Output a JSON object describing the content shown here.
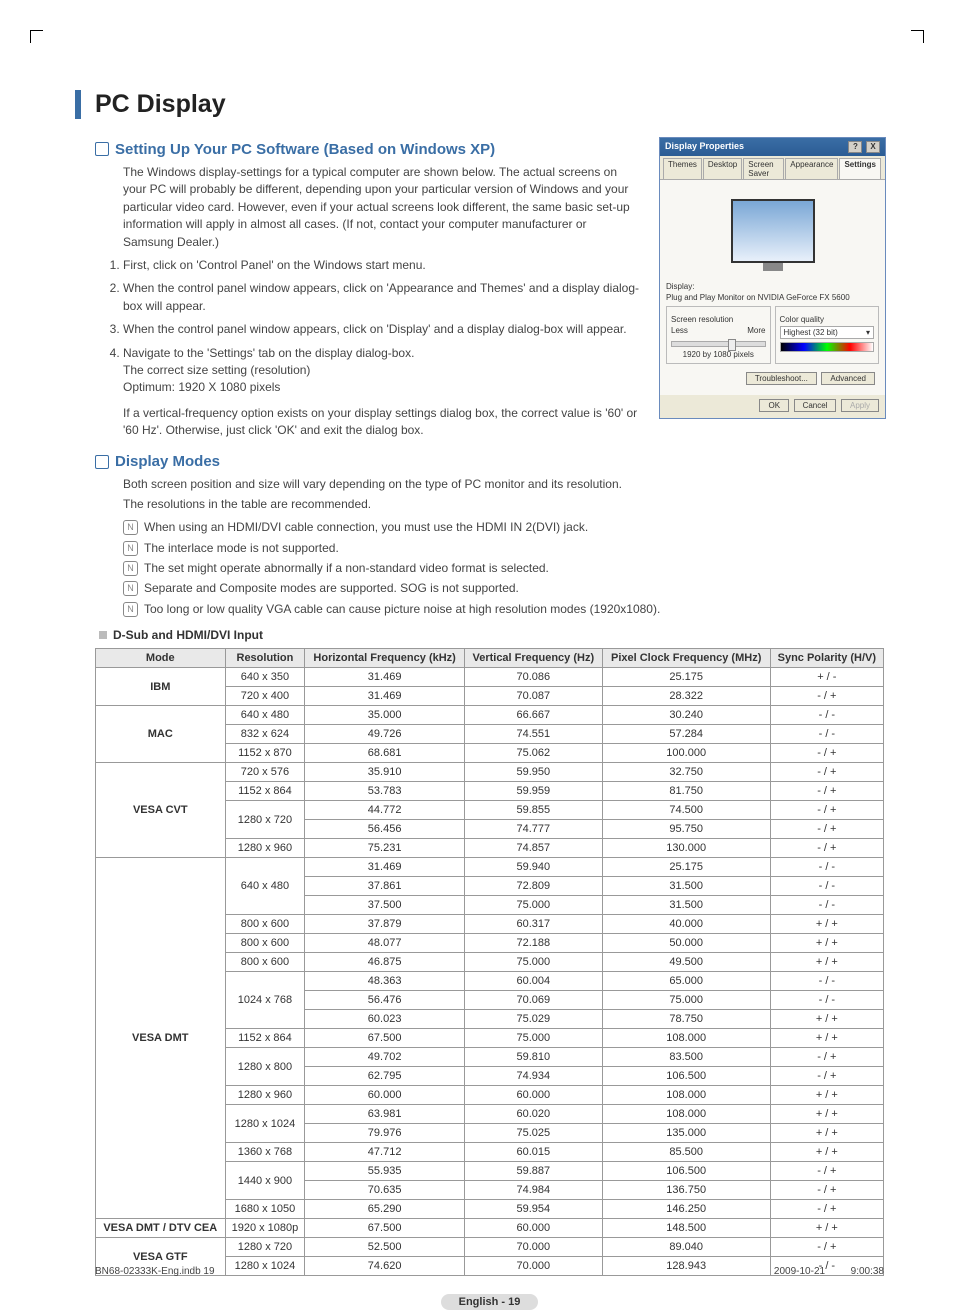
{
  "heading": "PC Display",
  "section1": {
    "title": "Setting Up Your PC Software (Based on Windows XP)",
    "intro": "The Windows display-settings for a typical computer are shown below. The actual screens on your PC will probably be different, depending upon your particular version of Windows and your particular video card. However, even if your actual screens look different, the same basic set-up information will apply in almost all cases. (If not, contact your computer manufacturer or Samsung Dealer.)",
    "steps": [
      "First, click on 'Control Panel' on the Windows start menu.",
      "When the control panel window appears, click on 'Appearance and Themes' and a display dialog-box will appear.",
      "When the control panel window appears, click on 'Display' and a display dialog-box will appear.",
      "Navigate to the 'Settings' tab on the display dialog-box."
    ],
    "step4_extra1": "The correct size setting (resolution)",
    "step4_extra2": "Optimum: 1920 X 1080 pixels",
    "step4_extra3": "If a vertical-frequency option exists on your display settings dialog box, the correct value is '60' or '60 Hz'. Otherwise, just click 'OK' and exit the dialog box."
  },
  "dialog": {
    "title": "Display Properties",
    "tabs": [
      "Themes",
      "Desktop",
      "Screen Saver",
      "Appearance",
      "Settings"
    ],
    "display_label": "Display:",
    "display_value": "Plug and Play Monitor on NVIDIA GeForce FX 5600",
    "sr_label": "Screen resolution",
    "sr_less": "Less",
    "sr_more": "More",
    "sr_value": "1920 by 1080 pixels",
    "cq_label": "Color quality",
    "cq_value": "Highest (32 bit)",
    "btn_trouble": "Troubleshoot...",
    "btn_adv": "Advanced",
    "btn_ok": "OK",
    "btn_cancel": "Cancel",
    "btn_apply": "Apply"
  },
  "section2": {
    "title": "Display Modes",
    "line1": "Both screen position and size will vary depending on the type of PC monitor and its resolution.",
    "line2": "The resolutions in the table are recommended.",
    "notes": [
      "When using an HDMI/DVI cable connection, you must use the HDMI IN 2(DVI) jack.",
      "The interlace mode is not supported.",
      "The set might operate abnormally if a non-standard video format is selected.",
      "Separate and Composite modes are supported. SOG is not supported.",
      "Too long or low quality VGA cable can cause picture noise at high resolution modes (1920x1080)."
    ],
    "subhead": "D-Sub and HDMI/DVI Input"
  },
  "table": {
    "headers": [
      "Mode",
      "Resolution",
      "Horizontal Frequency (kHz)",
      "Vertical Frequency (Hz)",
      "Pixel Clock Frequency (MHz)",
      "Sync Polarity (H/V)"
    ],
    "groups": [
      {
        "mode": "IBM",
        "rows": [
          [
            "640 x 350",
            "31.469",
            "70.086",
            "25.175",
            "+ / -"
          ],
          [
            "720 x 400",
            "31.469",
            "70.087",
            "28.322",
            "- / +"
          ]
        ]
      },
      {
        "mode": "MAC",
        "rows": [
          [
            "640 x 480",
            "35.000",
            "66.667",
            "30.240",
            "- / -"
          ],
          [
            "832 x 624",
            "49.726",
            "74.551",
            "57.284",
            "- / -"
          ],
          [
            "1152 x 870",
            "68.681",
            "75.062",
            "100.000",
            "- / +"
          ]
        ]
      },
      {
        "mode": "VESA CVT",
        "rows": [
          [
            "720 x 576",
            "35.910",
            "59.950",
            "32.750",
            "- / +"
          ],
          [
            "1152 x 864",
            "53.783",
            "59.959",
            "81.750",
            "- / +"
          ],
          [
            "1280 x 720",
            "44.772",
            "59.855",
            "74.500",
            "- / +"
          ],
          [
            "",
            "56.456",
            "74.777",
            "95.750",
            "- / +"
          ],
          [
            "1280 x 960",
            "75.231",
            "74.857",
            "130.000",
            "- / +"
          ]
        ],
        "res_spans": {
          "2": 2
        }
      },
      {
        "mode": "VESA DMT",
        "rows": [
          [
            "640 x 480",
            "31.469",
            "59.940",
            "25.175",
            "- / -"
          ],
          [
            "",
            "37.861",
            "72.809",
            "31.500",
            "- / -"
          ],
          [
            "",
            "37.500",
            "75.000",
            "31.500",
            "- / -"
          ],
          [
            "800 x 600",
            "37.879",
            "60.317",
            "40.000",
            "+ / +"
          ],
          [
            "800 x 600",
            "48.077",
            "72.188",
            "50.000",
            "+ / +"
          ],
          [
            "800 x 600",
            "46.875",
            "75.000",
            "49.500",
            "+ / +"
          ],
          [
            "1024 x 768",
            "48.363",
            "60.004",
            "65.000",
            "- / -"
          ],
          [
            "",
            "56.476",
            "70.069",
            "75.000",
            "- / -"
          ],
          [
            "",
            "60.023",
            "75.029",
            "78.750",
            "+ / +"
          ],
          [
            "1152 x 864",
            "67.500",
            "75.000",
            "108.000",
            "+ / +"
          ],
          [
            "1280 x 800",
            "49.702",
            "59.810",
            "83.500",
            "- / +"
          ],
          [
            "",
            "62.795",
            "74.934",
            "106.500",
            "- / +"
          ],
          [
            "1280 x 960",
            "60.000",
            "60.000",
            "108.000",
            "+ / +"
          ],
          [
            "1280 x 1024",
            "63.981",
            "60.020",
            "108.000",
            "+ / +"
          ],
          [
            "",
            "79.976",
            "75.025",
            "135.000",
            "+ / +"
          ],
          [
            "1360 x 768",
            "47.712",
            "60.015",
            "85.500",
            "+ / +"
          ],
          [
            "1440 x 900",
            "55.935",
            "59.887",
            "106.500",
            "- / +"
          ],
          [
            "",
            "70.635",
            "74.984",
            "136.750",
            "- / +"
          ],
          [
            "1680 x 1050",
            "65.290",
            "59.954",
            "146.250",
            "- / +"
          ]
        ],
        "res_spans": {
          "0": 3,
          "6": 3,
          "10": 2,
          "13": 2,
          "16": 2
        }
      },
      {
        "mode": "VESA DMT / DTV CEA",
        "rows": [
          [
            "1920 x 1080p",
            "67.500",
            "60.000",
            "148.500",
            "+ / +"
          ]
        ]
      },
      {
        "mode": "VESA GTF",
        "rows": [
          [
            "1280 x 720",
            "52.500",
            "70.000",
            "89.040",
            "- / +"
          ],
          [
            "1280 x 1024",
            "74.620",
            "70.000",
            "128.943",
            "- / -"
          ]
        ]
      }
    ]
  },
  "page_num": "English - 19",
  "footer_left": "BN68-02333K-Eng.indb   19",
  "footer_right": "2009-10-21      9:00:38"
}
